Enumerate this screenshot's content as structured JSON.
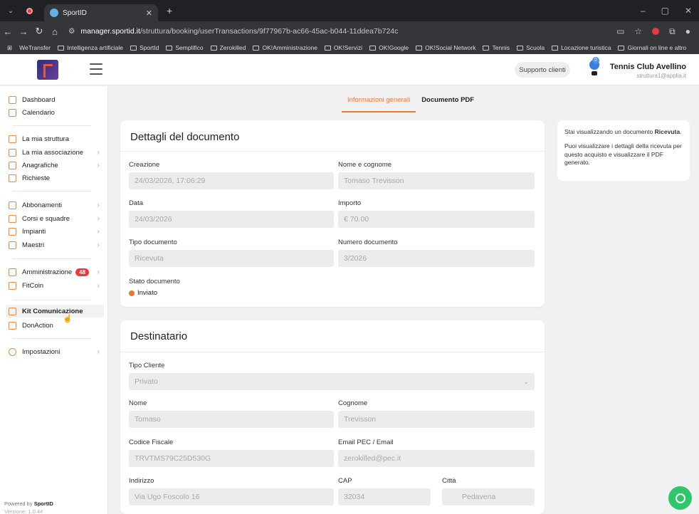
{
  "browser": {
    "tab_title": "SportID",
    "url_host": "manager.sportid.it",
    "url_path": "/struttura/booking/userTransactions/9f77967b-ac66-45ac-b044-11ddea7b724c",
    "bookmarks": [
      "WeTransfer",
      "Intelligenza artificiale",
      "SportId",
      "Semplifico",
      "Zerokilled",
      "OK!Amministrazione",
      "OK!Servizi",
      "OK!Google",
      "OK!Social Network",
      "Tennis",
      "Scuola",
      "Locazione turistica",
      "Giornali on line e altro"
    ]
  },
  "header": {
    "support_label": "Supporto clienti",
    "notif_count": "0",
    "club_name": "Tennis Club Avellino",
    "club_email": "struttura1@applia.it"
  },
  "sidebar": {
    "items": [
      {
        "label": "Dashboard"
      },
      {
        "label": "Calendario"
      },
      {
        "label": "La mia struttura"
      },
      {
        "label": "La mia associazione"
      },
      {
        "label": "Anagrafiche"
      },
      {
        "label": "Richieste"
      },
      {
        "label": "Abbonamenti"
      },
      {
        "label": "Corsi e squadre"
      },
      {
        "label": "Impianti"
      },
      {
        "label": "Maestri"
      },
      {
        "label": "Amministrazione",
        "badge": "48"
      },
      {
        "label": "FitCoin"
      },
      {
        "label": "Kit Comunicazione"
      },
      {
        "label": "DonAction"
      },
      {
        "label": "Impostazioni"
      }
    ],
    "powered_prefix": "Powered by ",
    "powered_brand": "SportID",
    "version": "Versione: 1.0.44"
  },
  "tabs": {
    "general": "Informazioni generali",
    "pdf": "Documento PDF"
  },
  "document": {
    "title": "Dettagli del documento",
    "creation_label": "Creazione",
    "creation_value": "24/03/2026, 17:06:29",
    "name_label": "Nome e cognome",
    "name_value": "Tomaso Trevisson",
    "date_label": "Data",
    "date_value": "24/03/2026",
    "amount_label": "Importo",
    "amount_value": "€ 70.00",
    "type_label": "Tipo documento",
    "type_value": "Ricevuta",
    "number_label": "Numero documento",
    "number_value": "3/2026",
    "state_label": "Stato documento",
    "state_value": "Inviato"
  },
  "recipient": {
    "title": "Destinatario",
    "client_type_label": "Tipo Cliente",
    "client_type_value": "Privato",
    "first_name_label": "Nome",
    "first_name_value": "Tomaso",
    "last_name_label": "Cognome",
    "last_name_value": "Trevisson",
    "tax_code_label": "Codice Fiscale",
    "tax_code_value": "TRVTMS79C25D530G",
    "email_label": "Email PEC / Email",
    "email_value": "zerokilled@pec.it",
    "address_label": "Indirizzo",
    "address_value": "Via Ugo Foscolo 16",
    "cap_label": "CAP",
    "cap_value": "32034",
    "city_label": "Città",
    "city_value": "Pedavena"
  },
  "info": {
    "line1_prefix": "Stai visualizzando un documento ",
    "line1_bold": "Ricevuta",
    "line1_suffix": ".",
    "line2": "Puoi visualizzare i dettagli della ricevuta per questo acquisto e visualizzare il PDF generato."
  },
  "colors": {
    "accent": "#e8783a",
    "badge": "#e83a3a",
    "whatsapp": "#2ec76b"
  }
}
